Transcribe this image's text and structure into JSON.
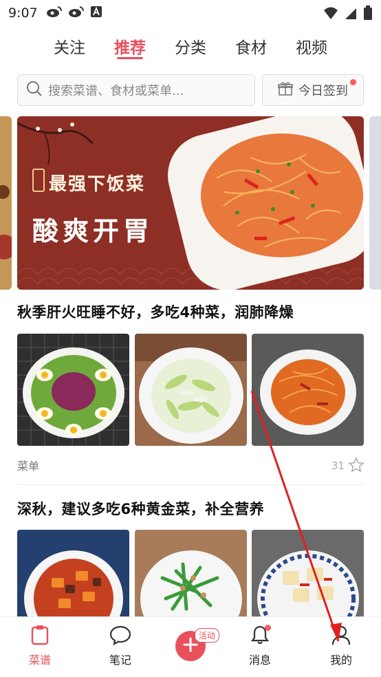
{
  "status_bar": {
    "time": "9:07"
  },
  "tabs": [
    {
      "label": "关注"
    },
    {
      "label": "推荐"
    },
    {
      "label": "分类"
    },
    {
      "label": "食材"
    },
    {
      "label": "视频"
    }
  ],
  "search": {
    "placeholder": "搜索菜谱、食材或菜单..."
  },
  "checkin": {
    "label": "今日签到"
  },
  "banner": {
    "line1": "最强下饭菜",
    "line2": "酸爽开胃"
  },
  "articles": [
    {
      "title": "秋季肝火旺睡不好，多吃4种菜，润肺降燥",
      "tag": "菜单",
      "count": "31"
    },
    {
      "title": "深秋，建议多吃6种黄金菜，补全营养"
    }
  ],
  "bottom_nav": [
    {
      "label": "菜谱"
    },
    {
      "label": "笔记"
    },
    {
      "label": "消息"
    },
    {
      "label": "我的"
    }
  ],
  "center_badge": "活动",
  "colors": {
    "accent": "#e8505b",
    "banner_bg": "#8e2f25"
  }
}
